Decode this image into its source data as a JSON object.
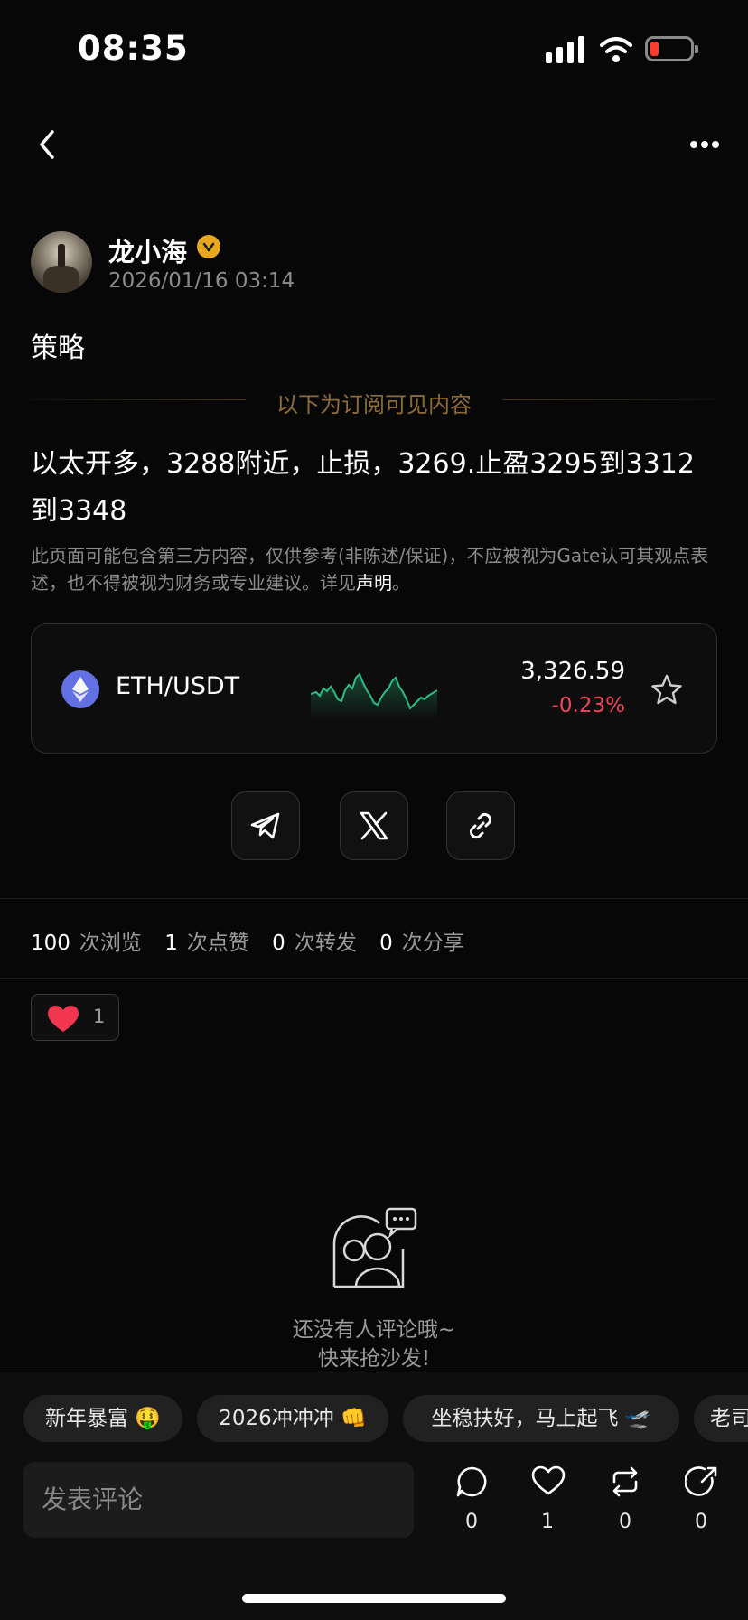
{
  "status_bar": {
    "time": "08:35"
  },
  "post": {
    "author": "龙小海",
    "timestamp": "2026/01/16 03:14",
    "title": "策略",
    "subscription_divider": "以下为订阅可见内容",
    "body": "以太开多，3288附近，止损，3269.止盈3295到3312到3348",
    "disclaimer_text": "此页面可能包含第三方内容，仅供参考(非陈述/保证)，不应被视为Gate认可其观点表述，也不得被视为财务或专业建议。详见",
    "disclaimer_link": "声明",
    "disclaimer_end": "。"
  },
  "ticker": {
    "pair": "ETH/USDT",
    "price": "3,326.59",
    "change": "-0.23%",
    "colors": {
      "up": "#2ebd85",
      "down": "#f0445a",
      "eth": "#6270e3"
    }
  },
  "share_buttons": [
    "telegram-icon",
    "x-icon",
    "link-icon"
  ],
  "stats": [
    {
      "value": "100",
      "label": "次浏览"
    },
    {
      "value": "1",
      "label": "次点赞"
    },
    {
      "value": "0",
      "label": "次转发"
    },
    {
      "value": "0",
      "label": "次分享"
    }
  ],
  "reaction": {
    "icon": "heart-icon",
    "count": "1"
  },
  "comments_empty": {
    "line1": "还没有人评论哦~",
    "line2": "快来抢沙发!"
  },
  "quick_replies": [
    "新年暴富 🤑",
    "2026冲冲冲 👊",
    "坐稳扶好，马上起飞 🛫",
    "老司"
  ],
  "comment_bar": {
    "placeholder": "发表评论",
    "comment_count": "0",
    "like_count": "1",
    "repost_count": "0",
    "share_count": "0"
  }
}
